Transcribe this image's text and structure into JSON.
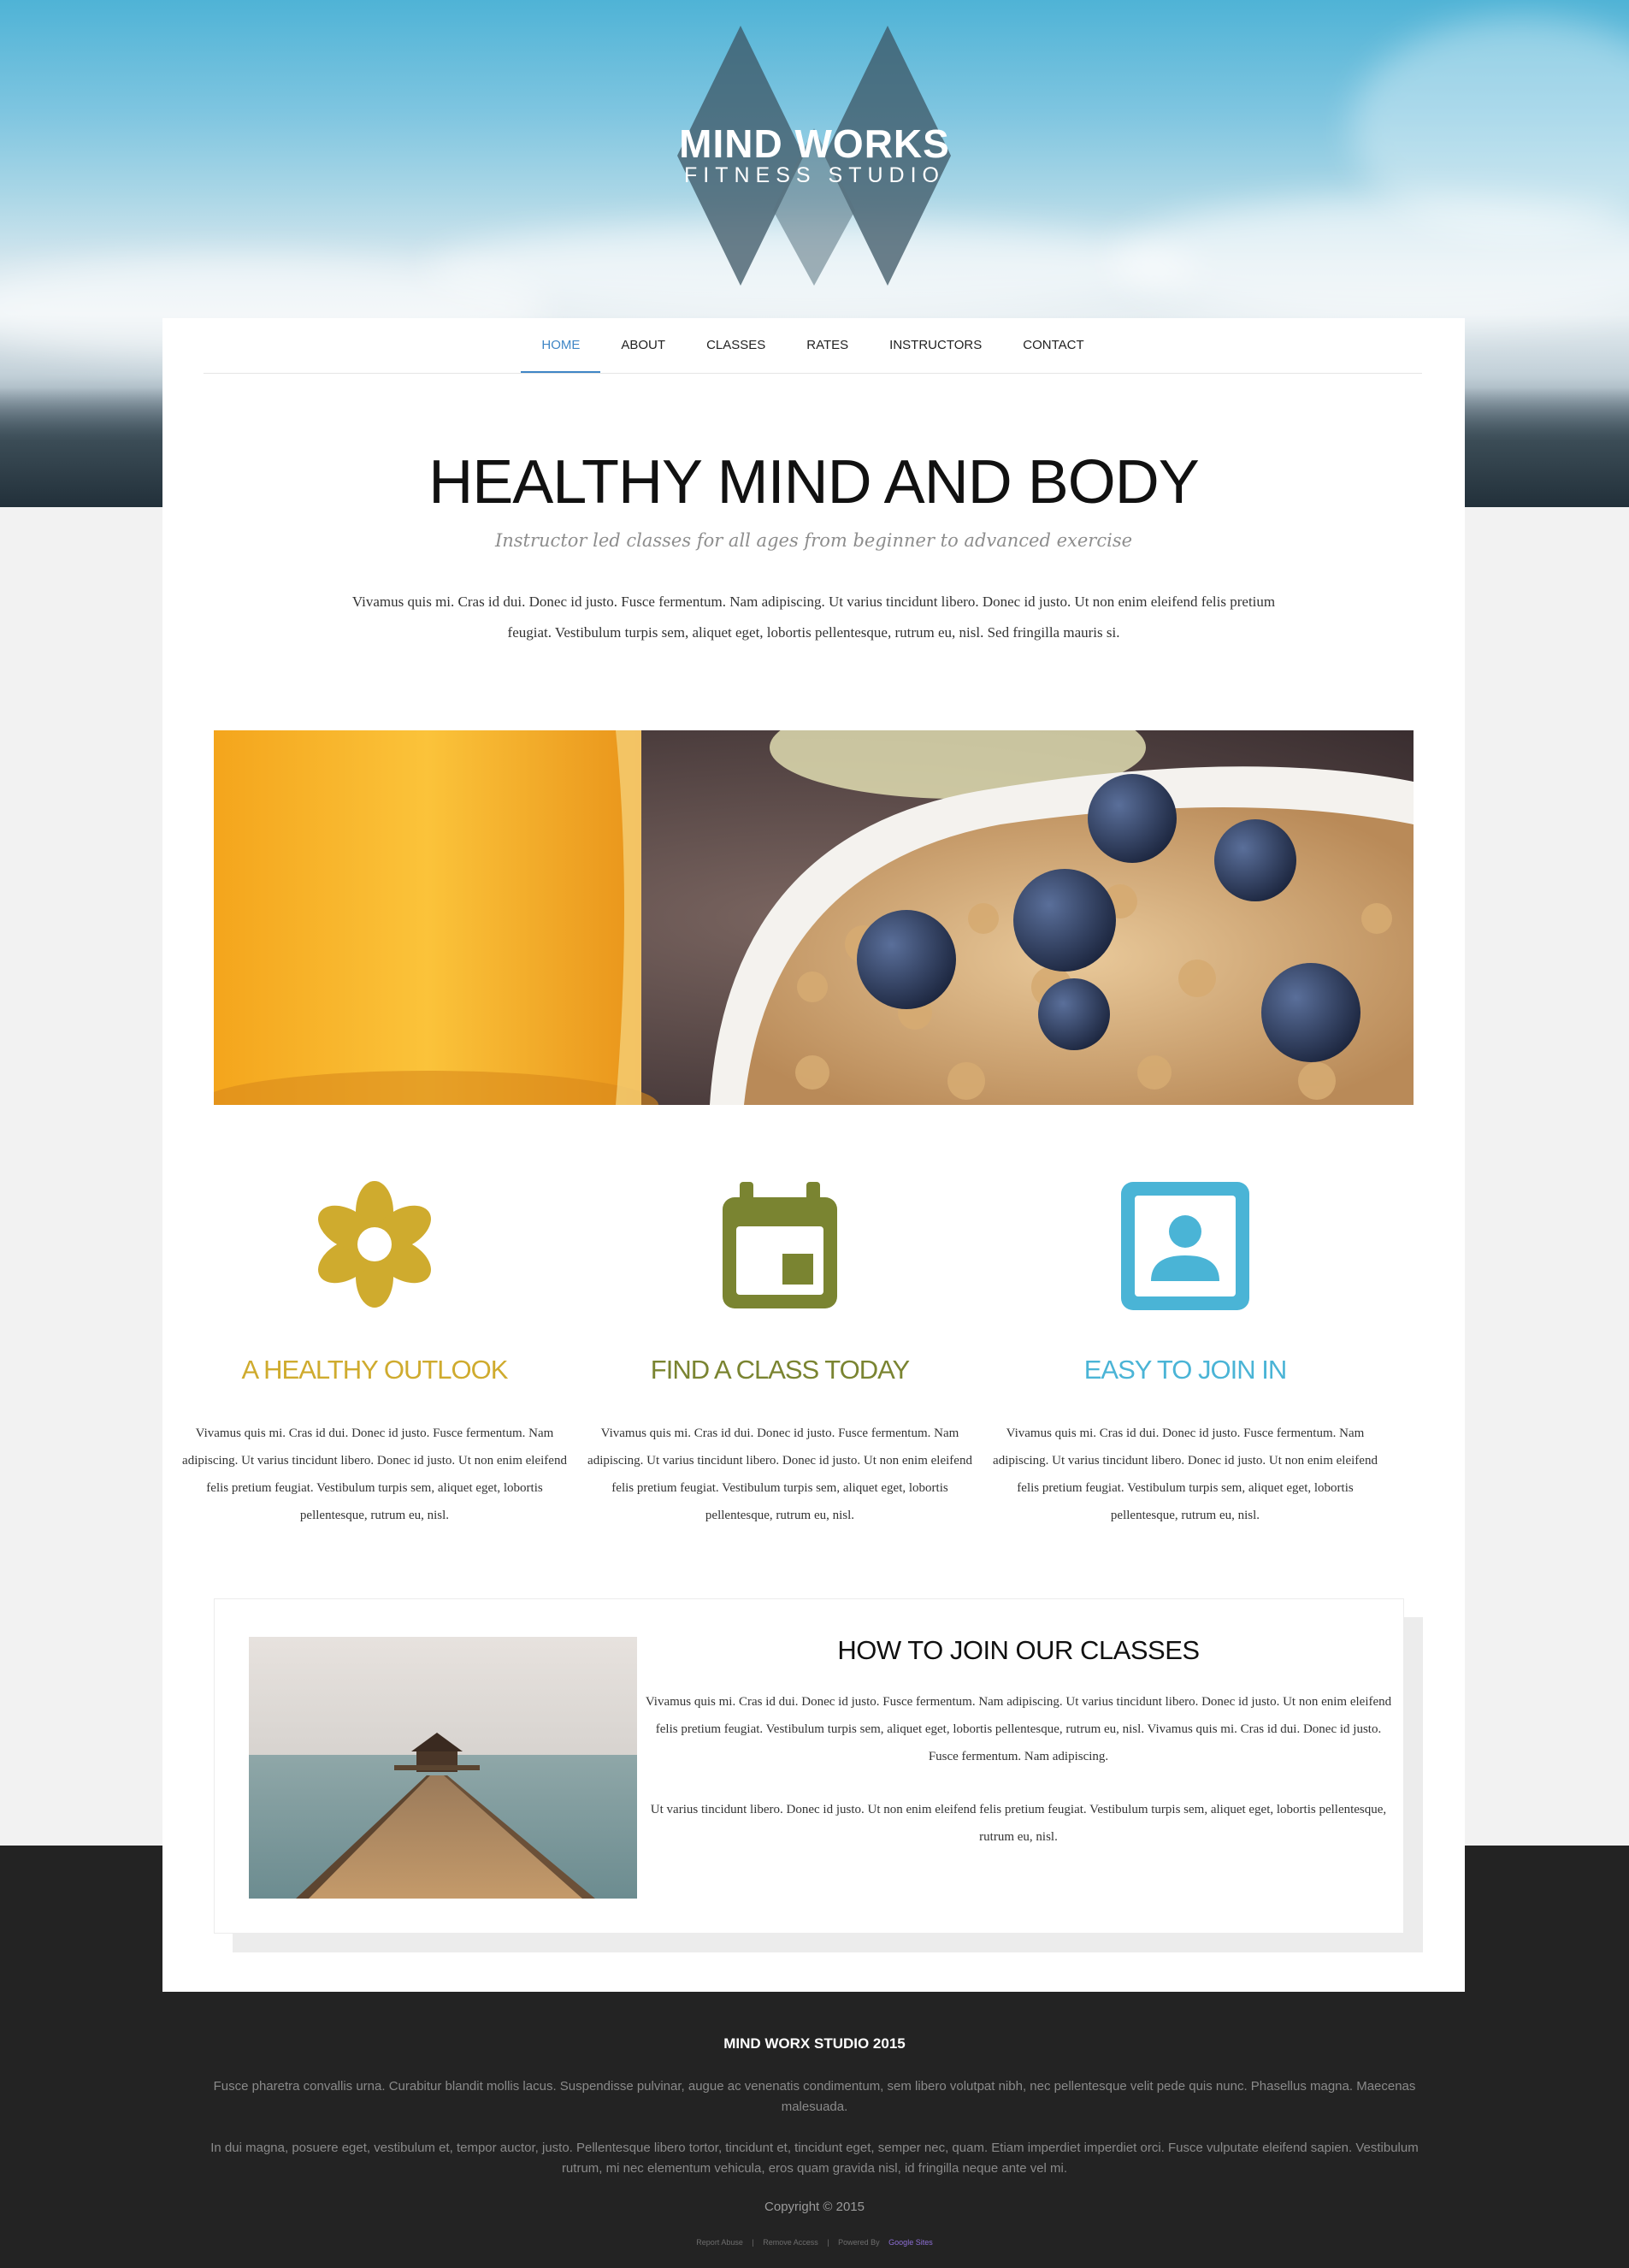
{
  "brand": {
    "name": "MIND WORKS",
    "subtitle": "FITNESS STUDIO"
  },
  "nav": {
    "items": [
      {
        "label": "HOME",
        "active": true
      },
      {
        "label": "ABOUT",
        "active": false
      },
      {
        "label": "CLASSES",
        "active": false
      },
      {
        "label": "RATES",
        "active": false
      },
      {
        "label": "INSTRUCTORS",
        "active": false
      },
      {
        "label": "CONTACT",
        "active": false
      }
    ]
  },
  "intro": {
    "headline": "HEALTHY MIND AND BODY",
    "tagline": "Instructor led classes for all ages from beginner to advanced exercise",
    "body": "Vivamus quis mi. Cras id dui. Donec id justo. Fusce fermentum. Nam adipiscing. Ut varius tincidunt libero. Donec id justo. Ut non enim eleifend felis pretium feugiat. Vestibulum turpis sem, aliquet eget, lobortis pellentesque, rutrum eu, nisl. Sed fringilla mauris si."
  },
  "features": [
    {
      "icon": "flower-icon",
      "color": "#cfab2e",
      "title": "A HEALTHY OUTLOOK",
      "text": "Vivamus quis mi. Cras id dui. Donec id justo. Fusce fermentum. Nam adipiscing. Ut varius tincidunt libero. Donec id justo. Ut non enim eleifend felis pretium feugiat. Vestibulum turpis sem, aliquet eget, lobortis pellentesque, rutrum eu, nisl."
    },
    {
      "icon": "calendar-icon",
      "color": "#7a8431",
      "title": "FIND A CLASS TODAY",
      "text": "Vivamus quis mi. Cras id dui. Donec id justo. Fusce fermentum. Nam adipiscing. Ut varius tincidunt libero. Donec id justo. Ut non enim eleifend felis pretium feugiat. Vestibulum turpis sem, aliquet eget, lobortis pellentesque, rutrum eu, nisl."
    },
    {
      "icon": "contact-card-icon",
      "color": "#4ab4d6",
      "title": "EASY TO JOIN IN",
      "text": "Vivamus quis mi. Cras id dui. Donec id justo. Fusce fermentum. Nam adipiscing. Ut varius tincidunt libero. Donec id justo. Ut non enim eleifend felis pretium feugiat. Vestibulum turpis sem, aliquet eget, lobortis pellentesque, rutrum eu, nisl."
    }
  ],
  "join": {
    "title": "HOW TO JOIN OUR CLASSES",
    "p1": "Vivamus quis mi. Cras id dui. Donec id justo. Fusce fermentum. Nam adipiscing. Ut varius tincidunt libero. Donec id justo. Ut non enim eleifend felis pretium feugiat. Vestibulum turpis sem, aliquet eget, lobortis pellentesque, rutrum eu, nisl. Vivamus quis mi. Cras id dui. Donec id justo. Fusce fermentum. Nam adipiscing.",
    "p2": "Ut varius tincidunt libero. Donec id justo. Ut non enim eleifend felis pretium feugiat. Vestibulum turpis sem, aliquet eget, lobortis pellentesque, rutrum eu, nisl."
  },
  "footer": {
    "title": "MIND WORX STUDIO 2015",
    "p1": "Fusce pharetra convallis urna. Curabitur blandit mollis lacus. Suspendisse pulvinar, augue ac venenatis condimentum, sem libero volutpat nibh, nec pellentesque velit pede quis nunc. Phasellus magna. Maecenas malesuada.",
    "p2": "In dui magna, posuere eget, vestibulum et, tempor auctor, justo. Pellentesque libero tortor, tincidunt et, tincidunt eget, semper nec, quam. Etiam imperdiet imperdiet orci. Fusce vulputate eleifend sapien. Vestibulum rutrum, mi nec elementum vehicula, eros quam gravida nisl, id fringilla neque ante vel mi.",
    "copyright": "Copyright © 2015",
    "links": {
      "report_abuse": "Report Abuse",
      "remove_access": "Remove Access",
      "powered_by": "Powered By",
      "google_sites": "Google Sites",
      "separator": "|"
    }
  },
  "colors": {
    "accent_nav": "#3f86c6",
    "footer_bg": "#232323"
  }
}
